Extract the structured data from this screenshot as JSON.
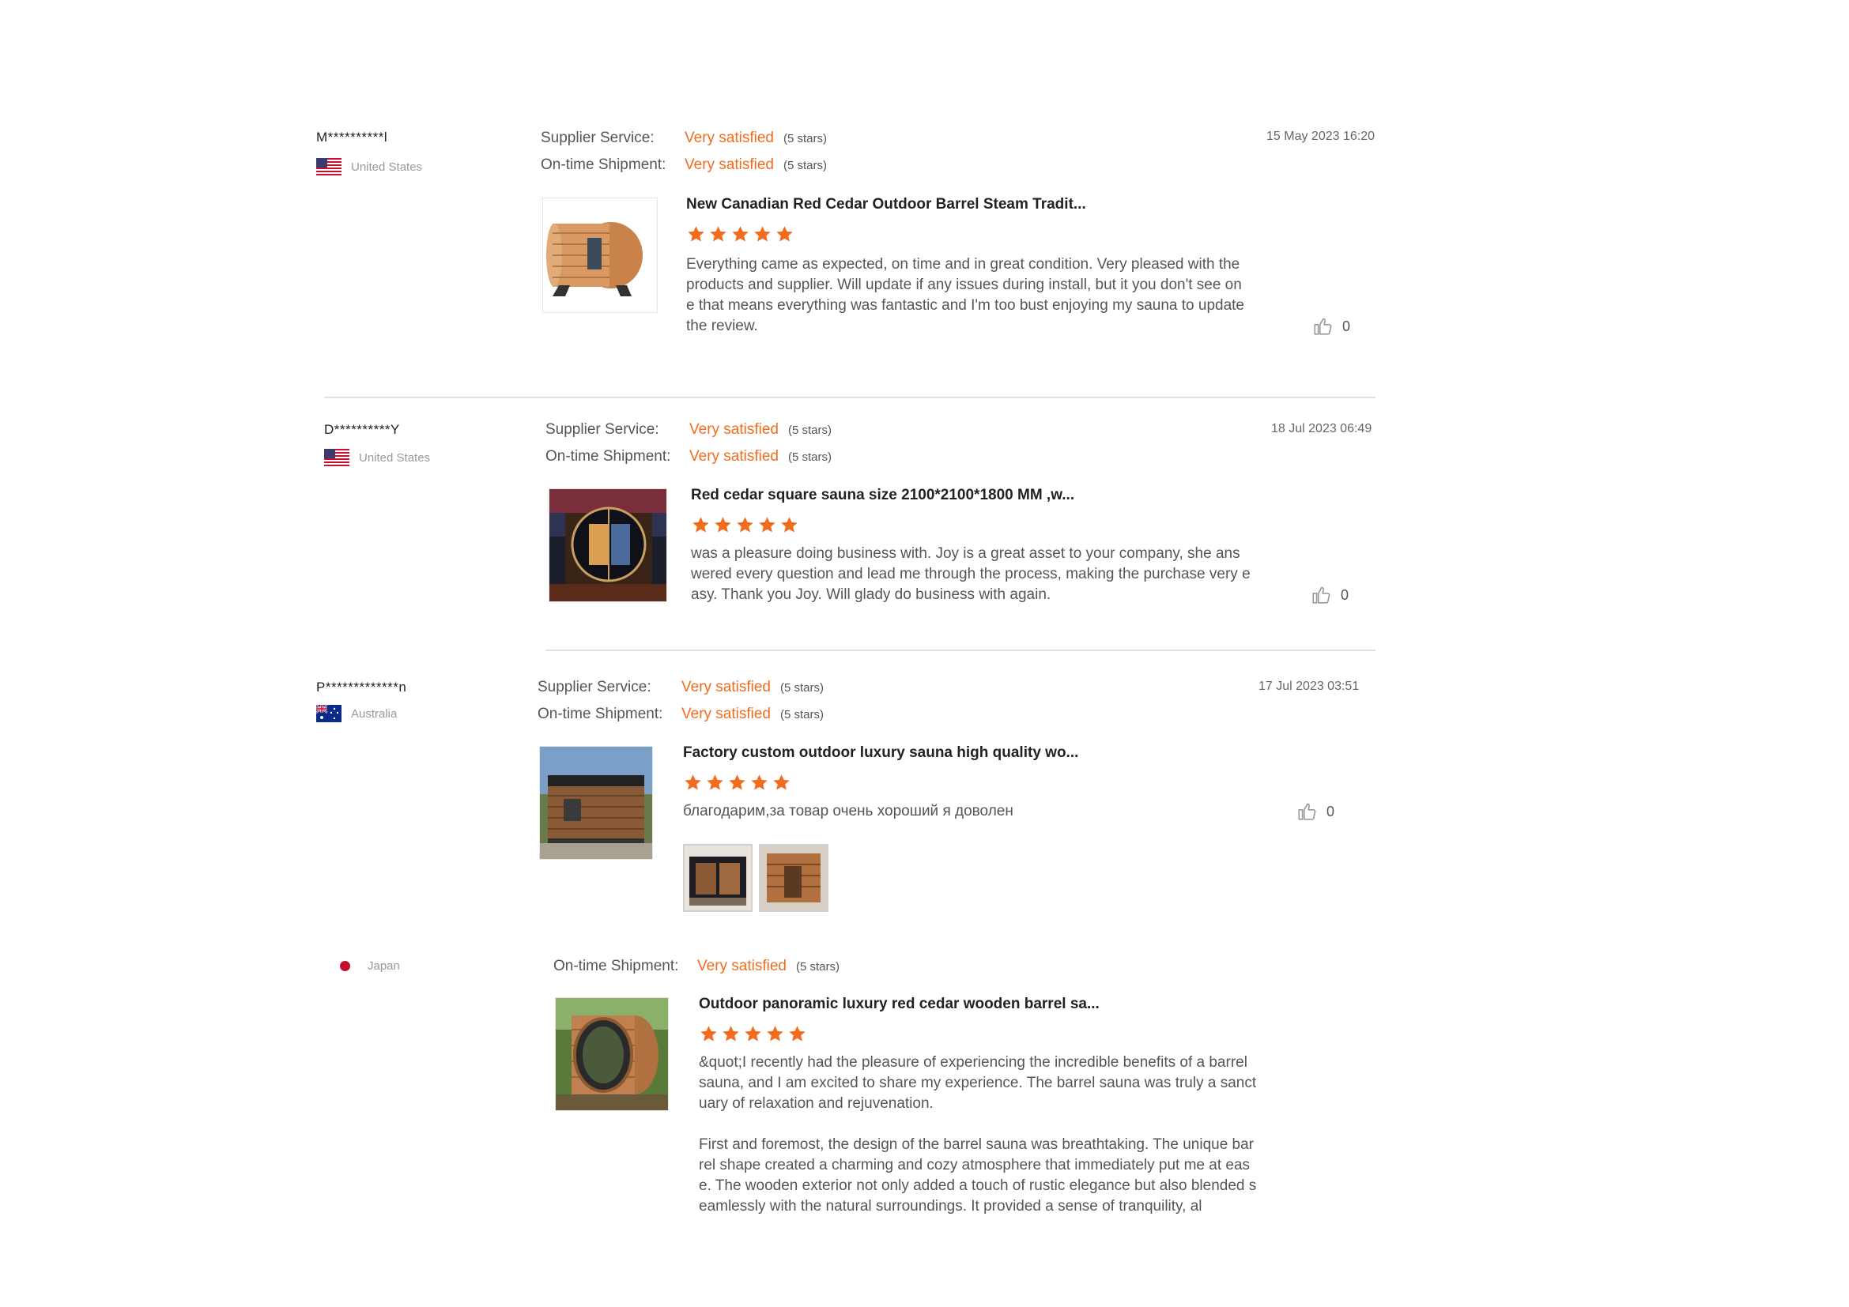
{
  "colors": {
    "accent": "#f16c1d",
    "divider": "#e3e3e3",
    "muted": "#999999"
  },
  "reviews": [
    {
      "buyer": "M**********l",
      "country": "United States",
      "country_flag": "us-flag-icon",
      "supplier_service_label": "Supplier Service:",
      "supplier_service_value": "Very satisfied",
      "supplier_service_note": "(5 stars)",
      "shipment_label": "On-time Shipment:",
      "shipment_value": "Very satisfied",
      "shipment_note": "(5 stars)",
      "date": "15 May 2023 16:20",
      "product_title": "New Canadian Red Cedar Outdoor Barrel Steam Tradit...",
      "rating": 5,
      "text": [
        "Everything came as expected, on time and in great condition. Very pleased with the products and supplier. Will update if any issues during install, but it you don't see one that means everything was fantastic and I'm too bust enjoying my sauna to update the review."
      ],
      "likes": "0"
    },
    {
      "buyer": "D**********Y",
      "country": "United States",
      "country_flag": "us-flag-icon",
      "supplier_service_label": "Supplier Service:",
      "supplier_service_value": "Very satisfied",
      "supplier_service_note": "(5 stars)",
      "shipment_label": "On-time Shipment:",
      "shipment_value": "Very satisfied",
      "shipment_note": "(5 stars)",
      "date": "18 Jul 2023 06:49",
      "product_title": "Red cedar square sauna size 2100*2100*1800 MM ,w...",
      "rating": 5,
      "text": [
        "was a pleasure doing business with. Joy is a great asset to your company, she answered every question and lead me through the process, making the purchase very easy. Thank you Joy. Will glady do business with again."
      ],
      "likes": "0"
    },
    {
      "buyer": "P*************n",
      "country": "Australia",
      "country_flag": "au-flag-icon",
      "supplier_service_label": "Supplier Service:",
      "supplier_service_value": "Very satisfied",
      "supplier_service_note": "(5 stars)",
      "shipment_label": "On-time Shipment:",
      "shipment_value": "Very satisfied",
      "shipment_note": "(5 stars)",
      "date": "17 Jul 2023 03:51",
      "product_title": "Factory custom outdoor luxury sauna high quality wo...",
      "rating": 5,
      "text": [
        "благодарим,за товар очень хороший я доволен"
      ],
      "likes": "0"
    },
    {
      "country": "Japan",
      "country_flag": "jp-flag-icon",
      "shipment_label": "On-time Shipment:",
      "shipment_value": "Very satisfied",
      "shipment_note": "(5 stars)",
      "product_title": "Outdoor panoramic luxury red cedar wooden barrel sa...",
      "rating": 5,
      "text": [
        "&quot;I recently had the pleasure of experiencing the incredible benefits of a barrel sauna, and I am excited to share my experience. The barrel sauna was truly a sanctuary of relaxation and rejuvenation.",
        "First and foremost, the design of the barrel sauna was breathtaking. The unique barrel shape created a charming and cozy atmosphere that immediately put me at ease. The wooden exterior not only added a touch of rustic elegance but also blended seamlessly with the natural surroundings. It provided a sense of tranquility, al"
      ]
    }
  ]
}
